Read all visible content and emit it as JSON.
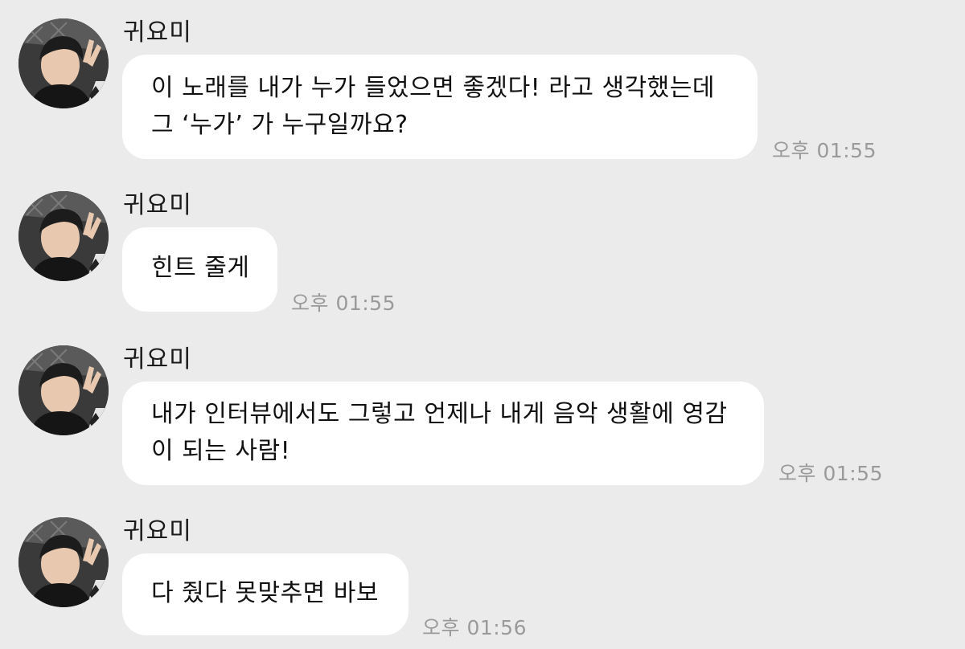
{
  "messages": [
    {
      "sender": "귀요미",
      "lines": [
        "이 노래를 내가 누가 들었으면 좋겠다! 라고 생각했는데",
        "그 ‘누가’ 가 누구일까요?"
      ],
      "time": "오후 01:55"
    },
    {
      "sender": "귀요미",
      "lines": [
        "힌트 줄게"
      ],
      "time": "오후 01:55"
    },
    {
      "sender": "귀요미",
      "lines": [
        "내가 인터뷰에서도 그렇고 언제나 내게 음악 생활에 영감",
        "이 되는 사람!"
      ],
      "time": "오후 01:55"
    },
    {
      "sender": "귀요미",
      "lines": [
        "다 줬다 못맞추면 바보"
      ],
      "time": "오후 01:56"
    }
  ],
  "colors": {
    "background": "#ebebeb",
    "bubble": "#ffffff",
    "timestamp": "#9a9a9a",
    "text": "#111111"
  },
  "icons": {
    "avatar": "profile-photo-avatar"
  }
}
